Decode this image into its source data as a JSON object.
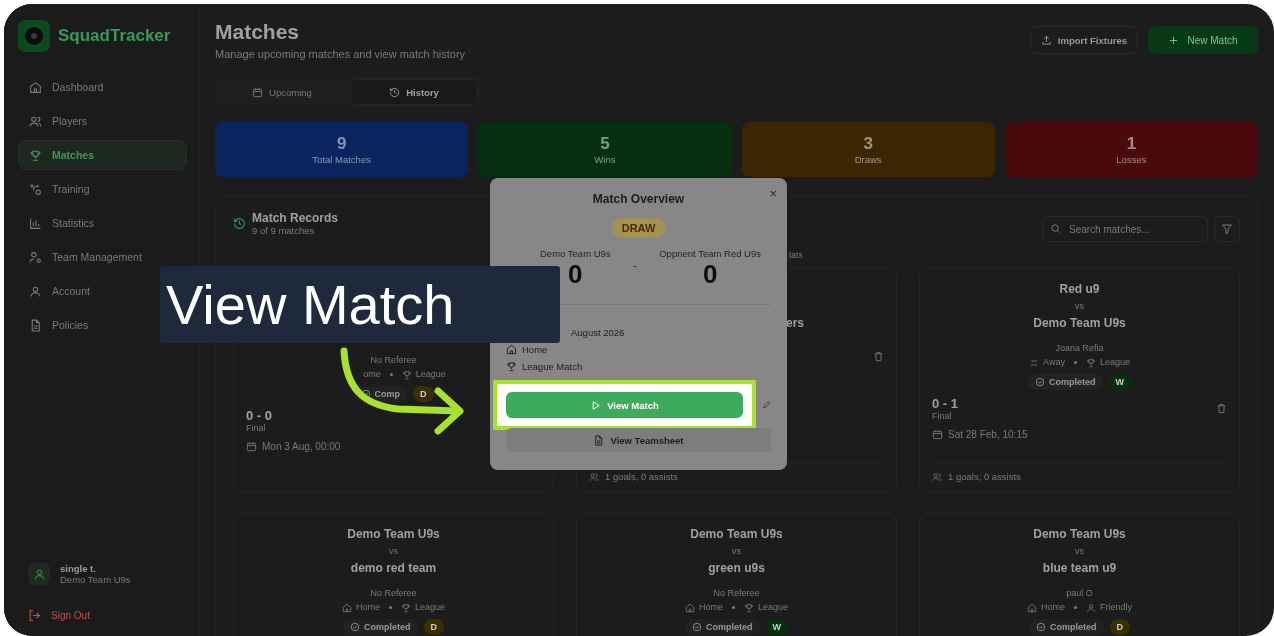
{
  "brand": {
    "name": "SquadTracker"
  },
  "sidebar": {
    "items": [
      {
        "label": "Dashboard",
        "selected": false
      },
      {
        "label": "Players",
        "selected": false
      },
      {
        "label": "Matches",
        "selected": true
      },
      {
        "label": "Training",
        "selected": false
      },
      {
        "label": "Statistics",
        "selected": false
      },
      {
        "label": "Team Management",
        "selected": false
      },
      {
        "label": "Account",
        "selected": false
      },
      {
        "label": "Policies",
        "selected": false
      }
    ],
    "user": {
      "name": "single t.",
      "team": "Demo Team U9s"
    },
    "sign_out": "Sign Out"
  },
  "header": {
    "title": "Matches",
    "subtitle": "Manage upcoming matches and view match history",
    "import_button": "Import Fixtures",
    "new_button": "New Match"
  },
  "tabs": [
    {
      "label": "Upcoming",
      "selected": false
    },
    {
      "label": "History",
      "selected": true
    }
  ],
  "stats": [
    {
      "value": "9",
      "label": "Total Matches",
      "color": "#0a2460"
    },
    {
      "value": "5",
      "label": "Wins",
      "color": "#04300f"
    },
    {
      "value": "3",
      "label": "Draws",
      "color": "#3a2600"
    },
    {
      "value": "1",
      "label": "Losses",
      "color": "#4a0a0c"
    }
  ],
  "records": {
    "title": "Match Records",
    "count": "9 of 9 matches",
    "stats_fragment": "tats",
    "search": {
      "placeholder": "Search matches..."
    }
  },
  "matches": [
    {
      "kind": "obscured",
      "referee": "No Referee",
      "meta": [
        {
          "kind": "cut",
          "label": "ome"
        },
        {
          "kind": "league",
          "label": "League"
        }
      ],
      "status": "Comp",
      "result": {
        "label": "D",
        "color": "#3a2f00"
      },
      "score": "0 - 0",
      "score_note": "Final",
      "date": "Mon 3 Aug, 00:00"
    },
    {
      "kind": "obscured",
      "away": "ers",
      "delete": true,
      "stats": "1 goals, 0 assists"
    },
    {
      "kind": "full",
      "home": "Red u9",
      "vs": "vs",
      "away": "Demo Team U9s",
      "referee": "Joana Refia",
      "meta": [
        {
          "kind": "away",
          "label": "Away"
        },
        {
          "kind": "league",
          "label": "League"
        }
      ],
      "status": "Completed",
      "result": {
        "label": "W",
        "color": "#04300f"
      },
      "score": "0 - 1",
      "score_note": "Final",
      "date": "Sat 28 Feb, 10:15",
      "delete": true,
      "stats": "1 goals, 0 assists"
    },
    {
      "kind": "full",
      "home": "Demo Team U9s",
      "vs": "vs",
      "away": "demo red team",
      "referee": "No Referee",
      "meta": [
        {
          "kind": "home",
          "label": "Home"
        },
        {
          "kind": "league",
          "label": "League"
        }
      ],
      "status": "Completed",
      "result": {
        "label": "D",
        "color": "#3a2f00"
      }
    },
    {
      "kind": "full",
      "home": "Demo Team U9s",
      "vs": "vs",
      "away": "green u9s",
      "referee": "No Referee",
      "meta": [
        {
          "kind": "home",
          "label": "Home"
        },
        {
          "kind": "league",
          "label": "League"
        }
      ],
      "status": "Completed",
      "result": {
        "label": "W",
        "color": "#04300f"
      }
    },
    {
      "kind": "full",
      "home": "Demo Team U9s",
      "vs": "vs",
      "away": "blue team u9",
      "referee": "paul O",
      "meta": [
        {
          "kind": "home",
          "label": "Home"
        },
        {
          "kind": "friendly",
          "label": "Friendly"
        }
      ],
      "status": "Completed",
      "result": {
        "label": "D",
        "color": "#3a2f00"
      }
    }
  ],
  "modal": {
    "title": "Match Overview",
    "close": "×",
    "result": "DRAW",
    "home_team": "Demo Team U9s",
    "home_score": "0",
    "separator": "-",
    "away_team": "Oppnent Team Red U9s",
    "away_score": "0",
    "date": "August 2026",
    "venue": "Home",
    "type": "League Match",
    "primary_button": "View Match",
    "secondary_button": "View Teamsheet"
  },
  "callout": {
    "text": "View Match"
  }
}
